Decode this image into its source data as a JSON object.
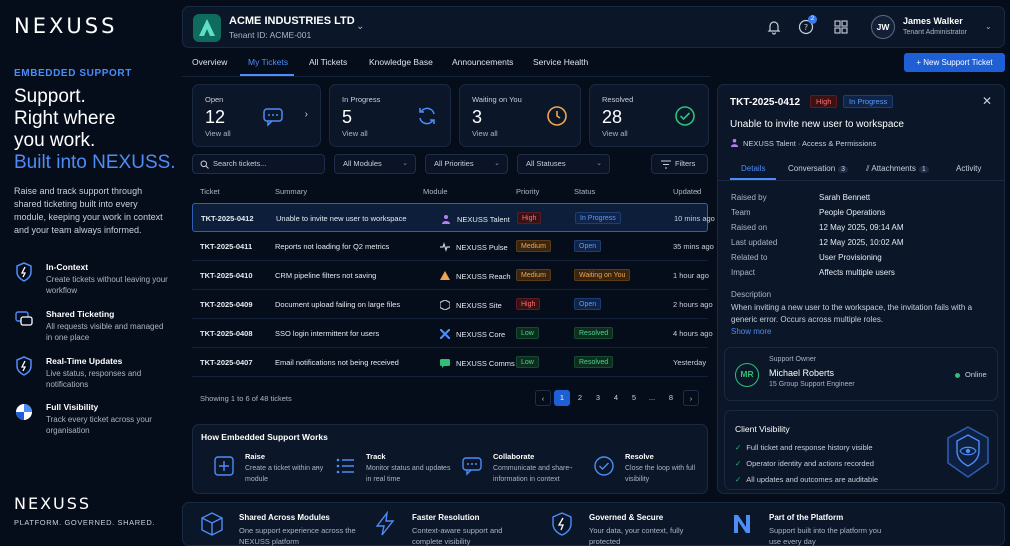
{
  "brand": {
    "logo": "NEXUSS",
    "tagline": "PLATFORM. GOVERNED. SHARED."
  },
  "promo": {
    "eyebrow": "EMBEDDED SUPPORT",
    "hero_line1": "Support.",
    "hero_line2": "Right where",
    "hero_line3": "you work.",
    "hero_line4": "Built into NEXUSS.",
    "intro": "Raise and track support through shared ticketing built into every module, keeping your work in context and your team always informed.",
    "features": [
      {
        "title": "In-Context",
        "desc": "Create tickets without leaving your workflow",
        "icon": "shield-icon"
      },
      {
        "title": "Shared Ticketing",
        "desc": "All requests visible and managed in one place",
        "icon": "chat-icon"
      },
      {
        "title": "Real-Time Updates",
        "desc": "Live status, responses and notifications",
        "icon": "bolt-shield-icon"
      },
      {
        "title": "Full Visibility",
        "desc": "Track every ticket across your organisation",
        "icon": "pie-icon"
      }
    ]
  },
  "header": {
    "company": "ACME INDUSTRIES LTD",
    "tenant": "Tenant ID: ACME-001",
    "help_badge": "2",
    "user_initials": "JW",
    "user_name": "James Walker",
    "user_role": "Tenant Administrator"
  },
  "nav": {
    "tabs": [
      "Overview",
      "My Tickets",
      "All Tickets",
      "Knowledge Base",
      "Announcements",
      "Service Health"
    ],
    "active": "My Tickets",
    "new_ticket": "+ New Support Ticket"
  },
  "stats": [
    {
      "label": "Open",
      "count": "12",
      "link": "View all",
      "color": "#4e8cf7"
    },
    {
      "label": "In Progress",
      "count": "5",
      "link": "View all",
      "color": "#4e8cf7"
    },
    {
      "label": "Waiting on You",
      "count": "3",
      "link": "View all",
      "color": "#f0a54c"
    },
    {
      "label": "Resolved",
      "count": "28",
      "link": "View all",
      "color": "#2fbf78"
    }
  ],
  "filters": {
    "search_placeholder": "Search tickets...",
    "modules": "All Modules",
    "priorities": "All Priorities",
    "statuses": "All Statuses",
    "filters_label": "Filters"
  },
  "table": {
    "headers": [
      "Ticket",
      "Summary",
      "Module",
      "Priority",
      "Status",
      "Updated"
    ],
    "rows": [
      {
        "id": "TKT-2025-0412",
        "summary": "Unable to invite new user to workspace",
        "module": "NEXUSS Talent",
        "priority": "High",
        "status": "In Progress",
        "updated": "10 mins ago"
      },
      {
        "id": "TKT-2025-0411",
        "summary": "Reports not loading for Q2 metrics",
        "module": "NEXUSS Pulse",
        "priority": "Medium",
        "status": "Open",
        "updated": "35 mins ago"
      },
      {
        "id": "TKT-2025-0410",
        "summary": "CRM pipeline filters not saving",
        "module": "NEXUSS Reach",
        "priority": "Medium",
        "status": "Waiting on You",
        "updated": "1 hour ago"
      },
      {
        "id": "TKT-2025-0409",
        "summary": "Document upload failing on large files",
        "module": "NEXUSS Site",
        "priority": "High",
        "status": "Open",
        "updated": "2 hours ago"
      },
      {
        "id": "TKT-2025-0408",
        "summary": "SSO login intermittent for users",
        "module": "NEXUSS Core",
        "priority": "Low",
        "status": "Resolved",
        "updated": "4 hours ago"
      },
      {
        "id": "TKT-2025-0407",
        "summary": "Email notifications not being received",
        "module": "NEXUSS Comms",
        "priority": "Low",
        "status": "Resolved",
        "updated": "Yesterday"
      }
    ],
    "showing": "Showing 1 to 6 of 48 tickets",
    "pages": [
      "1",
      "2",
      "3",
      "4",
      "5",
      "...",
      "8"
    ]
  },
  "how": {
    "title": "How Embedded Support Works",
    "steps": [
      {
        "title": "Raise",
        "desc": "Create a ticket within any module"
      },
      {
        "title": "Track",
        "desc": "Monitor status and updates in real time"
      },
      {
        "title": "Collaborate",
        "desc": "Communicate and share information in context"
      },
      {
        "title": "Resolve",
        "desc": "Close the loop with full visibility"
      }
    ]
  },
  "detail": {
    "id": "TKT-2025-0412",
    "priority": "High",
    "status": "In Progress",
    "title": "Unable to invite new user to workspace",
    "meta": "NEXUSS Talent  ·  Access & Permissions",
    "tabs": [
      {
        "label": "Details",
        "count": ""
      },
      {
        "label": "Conversation",
        "count": "3"
      },
      {
        "label": "Attachments",
        "count": "1"
      },
      {
        "label": "Activity",
        "count": ""
      }
    ],
    "fields": [
      {
        "k": "Raised by",
        "v": "Sarah Bennett"
      },
      {
        "k": "Team",
        "v": "People Operations"
      },
      {
        "k": "Raised on",
        "v": "12 May 2025, 09:14 AM"
      },
      {
        "k": "Last updated",
        "v": "12 May 2025, 10:02 AM"
      },
      {
        "k": "Related to",
        "v": "User Provisioning"
      },
      {
        "k": "Impact",
        "v": "Affects multiple users"
      }
    ],
    "desc_label": "Description",
    "desc": "When inviting a new user to the workspace, the invitation fails with a generic error. Occurs across multiple roles.",
    "show_more": "Show more",
    "owner": {
      "heading": "Support Owner",
      "initials": "MR",
      "name": "Michael Roberts",
      "role": "15 Group Support Engineer",
      "presence": "Online"
    },
    "client": {
      "heading": "Client Visibility",
      "items": [
        "Full ticket and response history visible",
        "Operator identity and actions recorded",
        "All updates and outcomes are auditable"
      ]
    }
  },
  "bottom": [
    {
      "title": "Shared Across Modules",
      "desc": "One support experience across the NEXUSS platform"
    },
    {
      "title": "Faster Resolution",
      "desc": "Context-aware support and complete visibility"
    },
    {
      "title": "Governed & Secure",
      "desc": "Your data, your context, fully protected"
    },
    {
      "title": "Part of the Platform",
      "desc": "Support built into the platform you use every day"
    }
  ]
}
